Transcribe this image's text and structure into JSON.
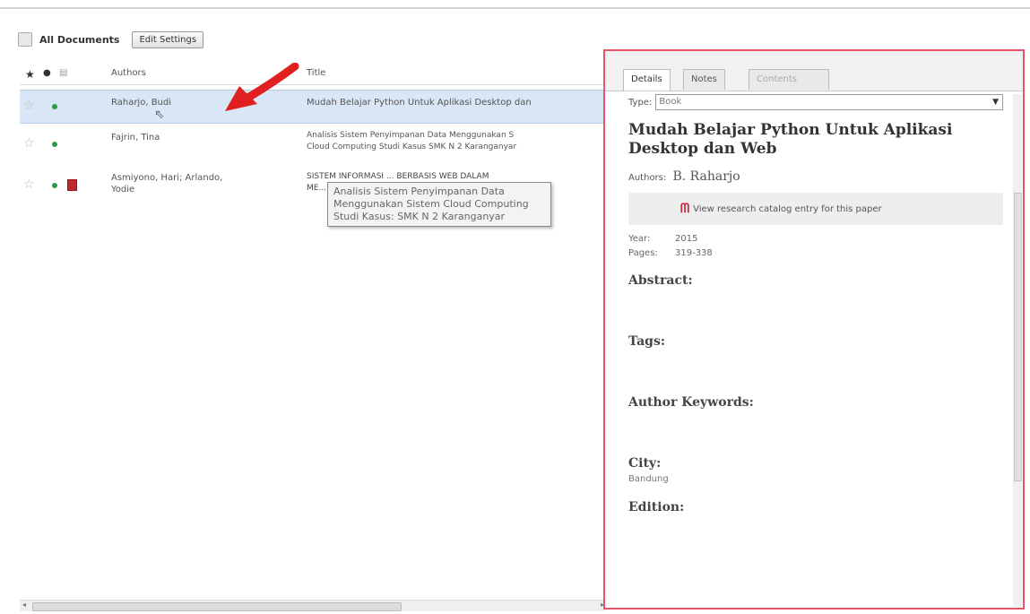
{
  "toolbar": {
    "title": "All Documents",
    "edit_settings": "Edit Settings"
  },
  "columns": {
    "star": "★",
    "read": "●",
    "file": "▤",
    "authors": "Authors",
    "title": "Title"
  },
  "rows": [
    {
      "authors": "Raharjo, Budi",
      "title": "Mudah Belajar Python Untuk Aplikasi Desktop dan",
      "selected": true,
      "pdf": false
    },
    {
      "authors": "Fajrin, Tina",
      "title": "Analisis Sistem Penyimpanan Data Menggunakan S",
      "title2": "Cloud Computing Studi Kasus SMK N 2 Karanganyar",
      "selected": false,
      "pdf": false
    },
    {
      "authors": "Asmiyono, Hari; Arlando,",
      "authors2": "Yodie",
      "title": "SISTEM INFORMASI ... BERBASIS WEB DALAM",
      "title2": "ME... DENGAN RE",
      "selected": false,
      "pdf": true
    }
  ],
  "tooltip": "Analisis Sistem Penyimpanan Data Menggunakan Sistem Cloud Computing Studi Kasus: SMK N 2 Karanganyar",
  "tabs": [
    "Details",
    "Notes",
    "Contents"
  ],
  "details": {
    "type_label": "Type:",
    "type_value": "Book",
    "title": "Mudah Belajar Python Untuk Aplikasi Desktop dan Web",
    "authors_label": "Authors:",
    "authors_value": "B. Raharjo",
    "catalog_text": "View research catalog entry for this paper",
    "year_label": "Year:",
    "year_value": "2015",
    "pages_label": "Pages:",
    "pages_value": "319-338",
    "abstract": "Abstract:",
    "tags": "Tags:",
    "author_keywords": "Author Keywords:",
    "city": "City:",
    "city_value": "Bandung",
    "edition": "Edition:"
  },
  "colors": {
    "highlight_border": "#e8546a",
    "selection": "#d8e6f5",
    "arrow": "#e02020",
    "mendeley": "#d0263a"
  }
}
